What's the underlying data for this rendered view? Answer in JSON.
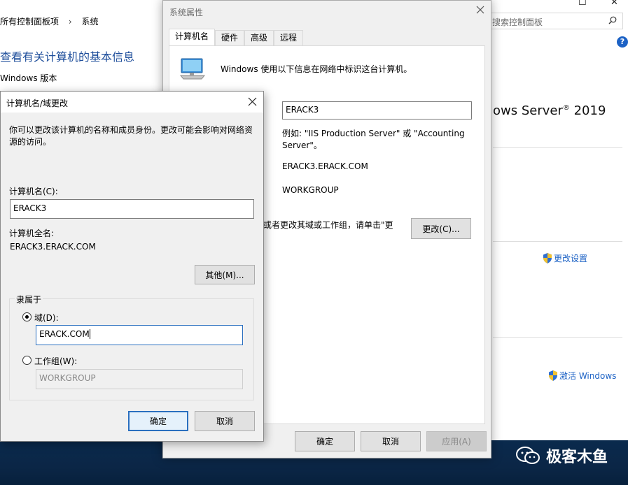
{
  "control_panel": {
    "breadcrumb": [
      "所有控制面板项",
      "系统"
    ],
    "breadcrumb_sep": "›",
    "search_placeholder": "搜索控制面板",
    "heading": "查看有关计算机的基本信息",
    "windows_version_label": "Windows 版本",
    "os_name_fragment": "ows Server",
    "os_reg": "®",
    "os_year": "2019",
    "change_settings_link": "更改设置",
    "activate_link": "激活 Windows",
    "help_glyph": "?"
  },
  "system_properties": {
    "title": "系统属性",
    "tabs": [
      "计算机名",
      "硬件",
      "高级",
      "远程"
    ],
    "active_tab": 0,
    "description": "Windows 使用以下信息在网络中标识这台计算机。",
    "computer_description_value": "ERACK3",
    "example_text": "例如: \"IIS Production Server\" 或 \"Accounting Server\"。",
    "full_name": "ERACK3.ERACK.COM",
    "workgroup": "WORKGROUP",
    "rename_hint": "或者更改其域或工作组，请单击\"更",
    "change_button": "更改(C)...",
    "ok_button": "确定",
    "cancel_button": "取消",
    "apply_button": "应用(A)"
  },
  "computer_name_dialog": {
    "title": "计算机名/域更改",
    "intro": "你可以更改该计算机的名称和成员身份。更改可能会影响对网络资源的访问。",
    "computer_name_label": "计算机名(C):",
    "computer_name_value": "ERACK3",
    "full_name_label": "计算机全名:",
    "full_name_value": "ERACK3.ERACK.COM",
    "more_button": "其他(M)...",
    "member_of_label": "隶属于",
    "domain_radio_label": "域(D):",
    "domain_value": "ERACK.COM",
    "workgroup_radio_label": "工作组(W):",
    "workgroup_value": "WORKGROUP",
    "selected": "domain",
    "ok_button": "确定",
    "cancel_button": "取消"
  },
  "watermark": {
    "text": "极客木鱼"
  },
  "colors": {
    "link_blue": "#1c62c5",
    "heading_blue": "#1e4e9b",
    "focus_blue": "#2a6fbf",
    "taskbar": "#0b2646"
  }
}
